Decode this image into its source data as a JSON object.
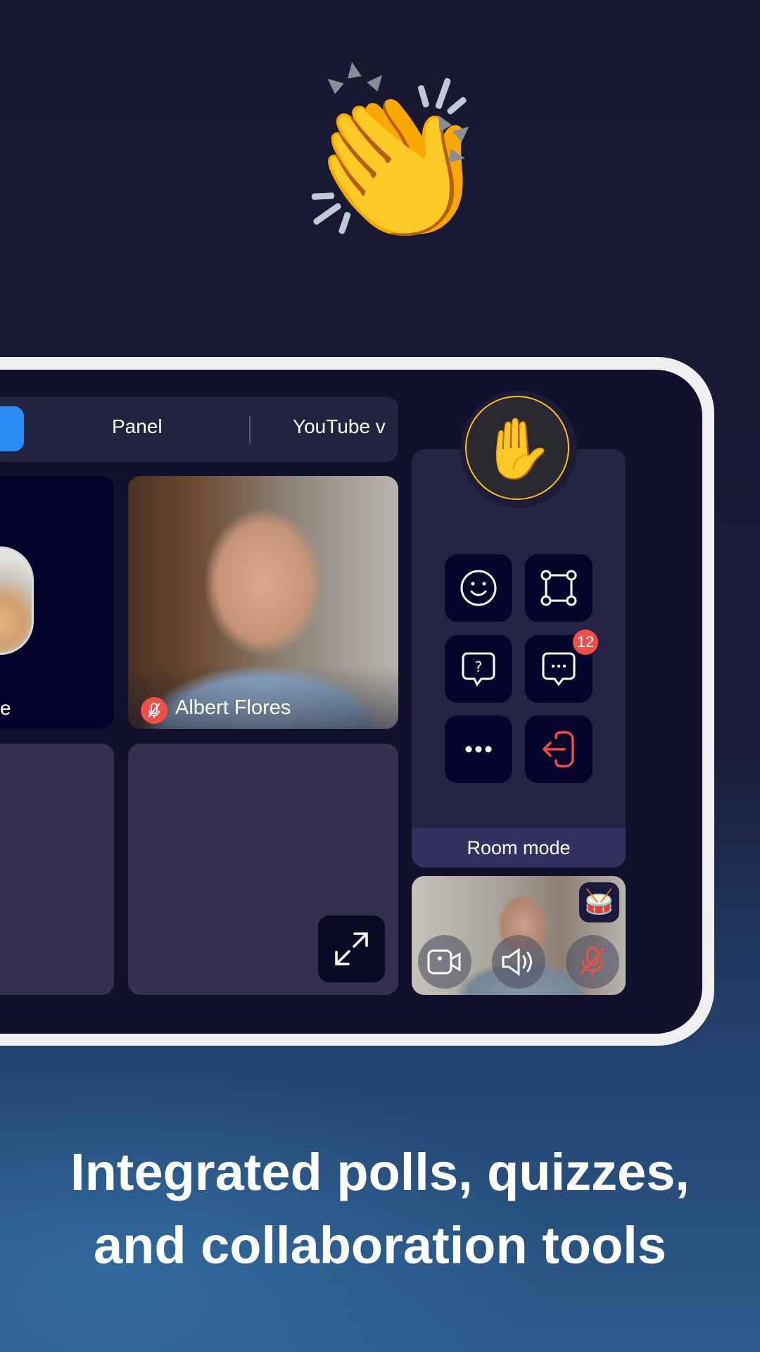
{
  "decor": {
    "clap_emoji": "👏",
    "hand_emoji": "✋",
    "drum_emoji": "🥁"
  },
  "tabs": [
    {
      "label": "",
      "active": true
    },
    {
      "label": "Panel",
      "active": false
    },
    {
      "label": "YouTube v",
      "active": false
    }
  ],
  "tiles": [
    {
      "name": "e"
    },
    {
      "name": "Albert Flores",
      "muted": true
    }
  ],
  "panel": {
    "controls": [
      "smile-icon",
      "layout-icon",
      "question-icon",
      "chat-icon",
      "more-icon",
      "exit-icon"
    ],
    "chat_badge": "12",
    "room_mode_label": "Room mode"
  },
  "colors": {
    "accent": "#2b8cf3",
    "danger": "#f04f48",
    "hand_ring": "#f2c21b"
  },
  "headline": {
    "line1": "Integrated polls, quizzes,",
    "line2": "and collaboration tools"
  }
}
